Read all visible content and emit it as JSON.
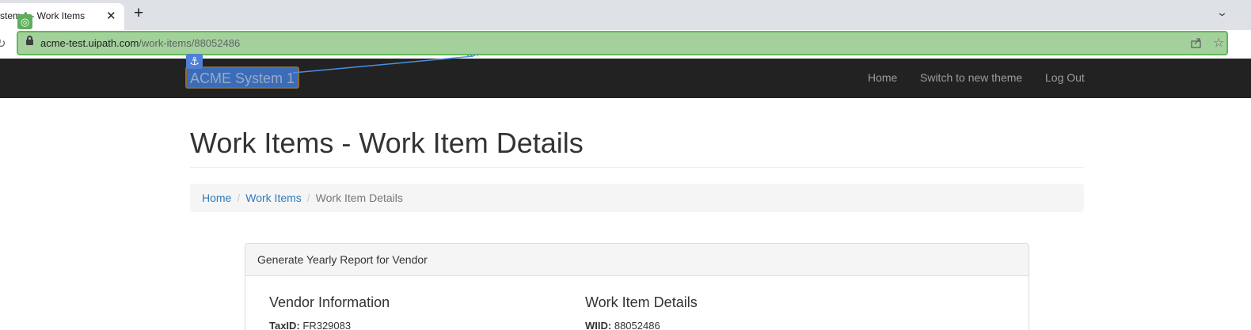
{
  "browser": {
    "tab_title": "stem 1 - Work Items",
    "close_glyph": "✕",
    "new_tab_glyph": "+",
    "tab_search_glyph": "⌄",
    "url_host": "acme-test.uipath.com",
    "url_path": "/work-items/88052486",
    "icons": [
      "reload-icon",
      "lock-icon",
      "share-icon",
      "bookmark-star-icon"
    ]
  },
  "overlay": {
    "target_glyph": "◎",
    "anchor_glyph": "⚓"
  },
  "navbar": {
    "brand": "ACME System 1",
    "links": [
      "Home",
      "Switch to new theme",
      "Log Out"
    ]
  },
  "page": {
    "title": "Work Items - Work Item Details",
    "breadcrumb": {
      "home": "Home",
      "work_items": "Work Items",
      "current": "Work Item Details",
      "separator": "/"
    }
  },
  "panel": {
    "heading": "Generate Yearly Report for Vendor",
    "vendor_section": "Vendor Information",
    "details_section": "Work Item Details",
    "tax_id_label": "TaxID:",
    "tax_id_value": "FR329083",
    "wiid_label": "WIID:",
    "wiid_value": "88052486"
  },
  "colors": {
    "navbar_bg": "#222222",
    "link": "#337ab7",
    "selection_green": "#a4d19b",
    "selection_blue": "#3b6cb7"
  }
}
